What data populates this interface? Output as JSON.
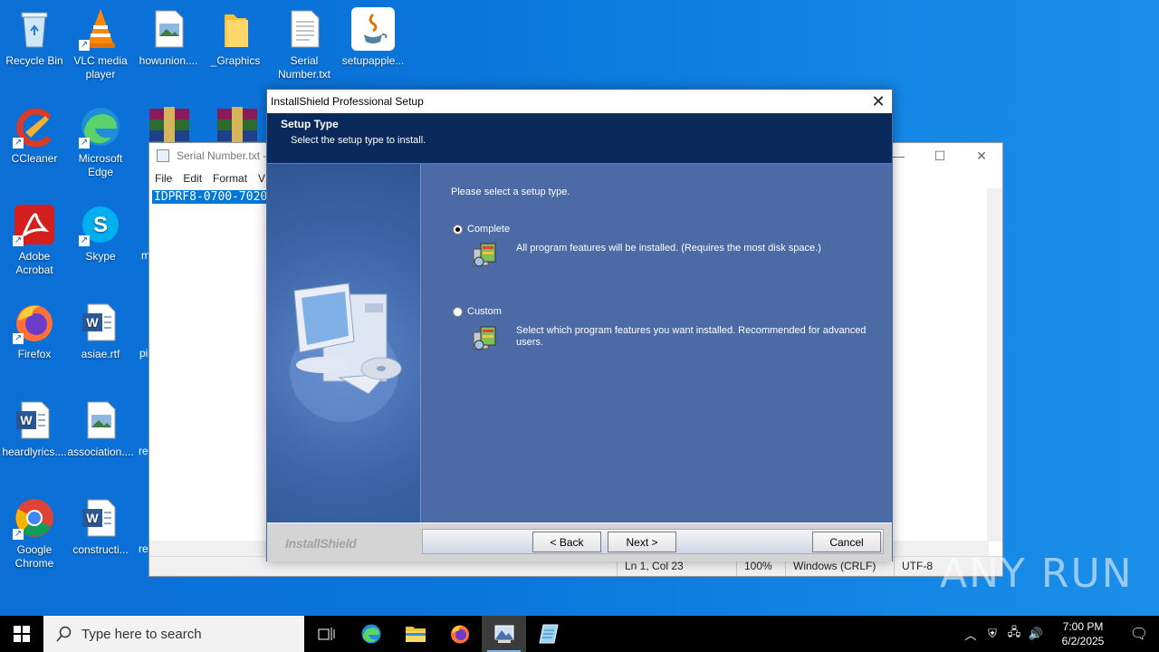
{
  "desktop": {
    "icons": [
      {
        "label": "Recycle Bin",
        "icon": "recycle-bin-icon"
      },
      {
        "label": "VLC media player",
        "icon": "vlc-icon"
      },
      {
        "label": "howunion....",
        "icon": "image-file-icon"
      },
      {
        "label": "_Graphics",
        "icon": "folder-icon"
      },
      {
        "label": "Serial Number.txt",
        "icon": "text-file-icon"
      },
      {
        "label": "setupapple...",
        "icon": "java-icon"
      },
      {
        "label": "CCleaner",
        "icon": "ccleaner-icon"
      },
      {
        "label": "Microsoft Edge",
        "icon": "edge-icon"
      },
      {
        "label": "Adobe Acrobat",
        "icon": "acrobat-icon"
      },
      {
        "label": "Skype",
        "icon": "skype-icon"
      },
      {
        "label": "Firefox",
        "icon": "firefox-icon"
      },
      {
        "label": "asiae.rtf",
        "icon": "word-doc-icon"
      },
      {
        "label": "heardlyrics....",
        "icon": "word-doc-icon"
      },
      {
        "label": "association....",
        "icon": "image-file-icon"
      },
      {
        "label": "Google Chrome",
        "icon": "chrome-icon"
      },
      {
        "label": "constructi...",
        "icon": "word-doc-icon"
      }
    ],
    "partial_labels": [
      "m",
      "pi",
      "re",
      "re"
    ]
  },
  "notepad": {
    "title": "Serial Number.txt -",
    "menu": [
      "File",
      "Edit",
      "Format",
      "V"
    ],
    "content": "IDPRF8-0700-7020",
    "status": {
      "position": "Ln 1, Col 23",
      "zoom": "100%",
      "line_ending": "Windows (CRLF)",
      "encoding": "UTF-8"
    }
  },
  "installer": {
    "window_title": "InstallShield Professional Setup",
    "header_title": "Setup Type",
    "header_subtitle": "Select the setup type to install.",
    "prompt": "Please select a setup type.",
    "options": [
      {
        "label": "Complete",
        "selected": true,
        "description": "All program features will be installed. (Requires the most disk space.)"
      },
      {
        "label": "Custom",
        "selected": false,
        "description": "Select which program features you want installed. Recommended for advanced users."
      }
    ],
    "brand": "InstallShield",
    "buttons": {
      "back": "< Back",
      "next": "Next >",
      "cancel": "Cancel"
    }
  },
  "taskbar": {
    "search_placeholder": "Type here to search",
    "time": "7:00 PM",
    "date": "6/2/2025"
  },
  "watermark": "ANY RUN",
  "colors": {
    "desktop_bg": "#0a75db",
    "dialog_blue": "#4b6aa6",
    "header_navy": "#0b2a5c",
    "taskbar": "#000000"
  }
}
